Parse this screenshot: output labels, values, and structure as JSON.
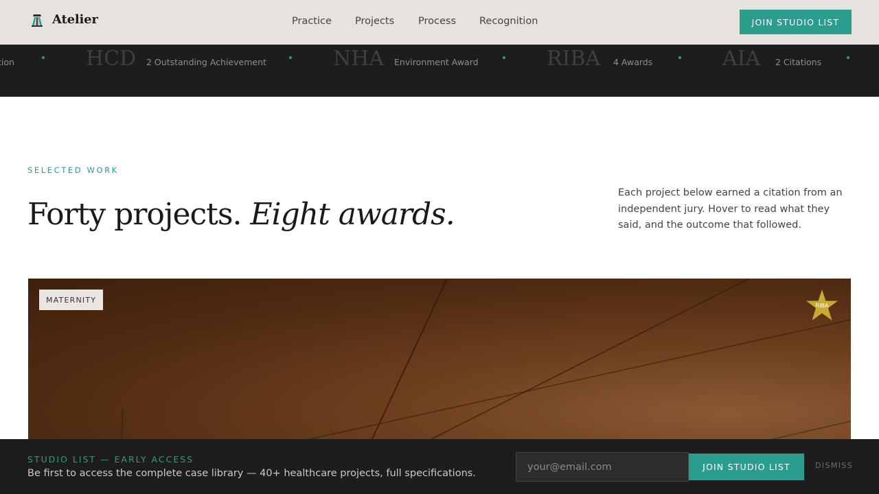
{
  "header": {
    "brand_name": "Atelier",
    "logo_icon": "studio-logo-icon",
    "nav": [
      {
        "label": "Practice"
      },
      {
        "label": "Projects"
      },
      {
        "label": "Process"
      },
      {
        "label": "Recognition"
      }
    ],
    "cta_label": "JOIN STUDIO LIST"
  },
  "ticker": {
    "items": [
      {
        "abbr": "",
        "desc": "tion"
      },
      {
        "abbr": "HCD",
        "desc": "2 Outstanding Achievement"
      },
      {
        "abbr": "NHA",
        "desc": "Environment Award"
      },
      {
        "abbr": "RIBA",
        "desc": "4 Awards"
      },
      {
        "abbr": "AIA",
        "desc": "2 Citations"
      }
    ]
  },
  "section": {
    "eyebrow": "SELECTED WORK",
    "headline_regular": "Forty projects.",
    "headline_italic": "Eight awards.",
    "intro": "Each project below earned a citation from an independent jury. Hover to read what they said, and the outcome that followed."
  },
  "project_card": {
    "category": "MATERNITY",
    "award_badge": "RIBA",
    "award_icon": "star-icon"
  },
  "signup": {
    "eyebrow": "STUDIO LIST — EARLY ACCESS",
    "text": "Be first to access the complete case library — 40+ healthcare projects, full specifications.",
    "email_placeholder": "your@email.com",
    "email_value": "",
    "button_label": "JOIN STUDIO LIST",
    "dismiss_label": "DISMISS"
  },
  "colors": {
    "accent": "#2a9d8f",
    "header_bg": "#e6e2de",
    "dark_bg": "#1d1d1d",
    "award_gold": "#c9a932"
  }
}
